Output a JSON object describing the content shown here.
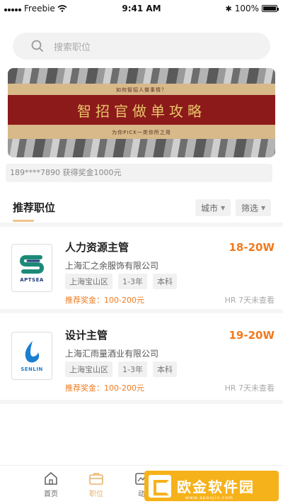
{
  "status_bar": {
    "carrier": "Freebie",
    "time": "9:41 AM",
    "battery": "100%",
    "battery_level": 1.0
  },
  "search": {
    "placeholder": "搜索职位"
  },
  "banner": {
    "subtitle": "如何智招人做事情？",
    "title": "智招官做单攻略",
    "footer": "为你PICK一类你所之用"
  },
  "ticker": {
    "text": "189****7890 获得奖金1000元"
  },
  "section": {
    "title": "推荐职位",
    "filter_city": "城市",
    "filter_screen": "筛选"
  },
  "jobs": [
    {
      "title": "人力资源主管",
      "salary": "18-20W",
      "company": "上海汇之余服饰有限公司",
      "tags": [
        "上海宝山区",
        "1-3年",
        "本科"
      ],
      "reward": "推荐奖金：100-200元",
      "hr_status": "HR 7天未查看",
      "logo_text": "APTSEA",
      "logo_color": "#1c8a78"
    },
    {
      "title": "设计主管",
      "salary": "19-20W",
      "company": "上海汇雨量酒业有限公司",
      "tags": [
        "上海宝山区",
        "1-3年",
        "本科"
      ],
      "reward": "推荐奖金：100-200元",
      "hr_status": "HR 7天未查看",
      "logo_text": "SENLIN",
      "logo_color": "#1a7fd0"
    }
  ],
  "tabbar": {
    "items": [
      {
        "label": "首页",
        "icon": "home-icon"
      },
      {
        "label": "职位",
        "icon": "briefcase-icon",
        "active": true
      },
      {
        "label": "动",
        "icon": "chart-icon"
      }
    ]
  },
  "watermark": {
    "text": "欧金软件园",
    "url": "www.apoujin.com"
  },
  "colors": {
    "accent": "#f07a1e",
    "tab_active": "#e8b46a",
    "banner_red": "#8d1a1a",
    "banner_gold": "#d7b98a"
  }
}
